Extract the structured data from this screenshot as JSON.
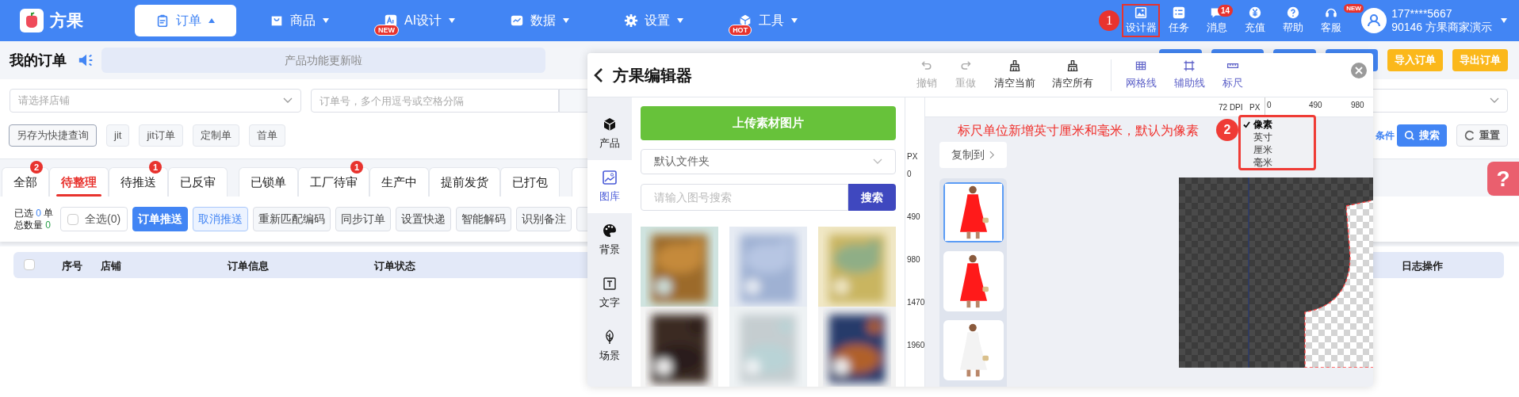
{
  "top_nav": {
    "brand": "方果",
    "items": [
      {
        "label": "订单",
        "selected": true
      },
      {
        "label": "商品",
        "selected": false
      },
      {
        "label": "AI设计",
        "selected": false,
        "tag": "NEW"
      },
      {
        "label": "数据",
        "selected": false
      },
      {
        "label": "设置",
        "selected": false
      },
      {
        "label": "工具",
        "selected": false,
        "tag": "HOT"
      }
    ],
    "tools": [
      {
        "label": "设计器",
        "highlighted": true,
        "callout": "1"
      },
      {
        "label": "任务",
        "highlighted": false
      },
      {
        "label": "消息",
        "highlighted": false,
        "badge": "14"
      },
      {
        "label": "充值",
        "highlighted": false
      },
      {
        "label": "帮助",
        "highlighted": false
      },
      {
        "label": "客服",
        "highlighted": false,
        "tag": "NEW"
      }
    ],
    "user": {
      "phone": "177****5667",
      "account": "90146 方果商家演示"
    }
  },
  "page": {
    "title": "我的订单",
    "notice": "产品功能更新啦",
    "header_buttons": [
      "导入订单",
      "导出订单"
    ]
  },
  "filters": {
    "shop_select": {
      "placeholder": "请选择店铺"
    },
    "order_input": {
      "placeholder": "订单号，多个用逗号或空格分隔"
    },
    "quick_queries": [
      {
        "label": "另存为快捷查询",
        "kind": "save"
      },
      {
        "label": "jit",
        "kind": "query"
      },
      {
        "label": "jit订单",
        "kind": "query"
      },
      {
        "label": "定制单",
        "kind": "query"
      },
      {
        "label": "首单",
        "kind": "query"
      }
    ],
    "more_link": "条件",
    "search_button": "搜索",
    "reset_button": "重置"
  },
  "status_tab_groups": [
    {
      "tabs": [
        {
          "label": "全部",
          "selected": false,
          "badge": "2"
        },
        {
          "label": "待整理",
          "selected": true
        },
        {
          "label": "待推送",
          "selected": false,
          "badge": "1"
        },
        {
          "label": "已反审",
          "selected": false
        }
      ]
    },
    {
      "tabs": [
        {
          "label": "已锁单",
          "selected": false
        },
        {
          "label": "工厂待审",
          "selected": false,
          "badge": "1"
        },
        {
          "label": "生产中",
          "selected": false
        },
        {
          "label": "提前发货",
          "selected": false
        },
        {
          "label": "已打包",
          "selected": false
        }
      ]
    }
  ],
  "summary": {
    "selected_label": "已选",
    "selected_count": "0",
    "selected_unit": "单",
    "total_label": "总数量",
    "total_count": "0"
  },
  "select_all": {
    "label": "全选(0)",
    "checked": false
  },
  "actions": [
    {
      "label": "订单推送",
      "kind": "primary"
    },
    {
      "label": "取消推送",
      "kind": "outline"
    },
    {
      "label": "重新匹配编码",
      "kind": "default"
    },
    {
      "label": "同步订单",
      "kind": "default"
    },
    {
      "label": "设置快递",
      "kind": "default"
    },
    {
      "label": "智能解码",
      "kind": "default"
    },
    {
      "label": "识别备注",
      "kind": "default"
    }
  ],
  "table": {
    "header_checked": false,
    "columns": [
      "序号",
      "店铺",
      "订单信息",
      "订单状态",
      "日志操作"
    ]
  },
  "help_tab": {
    "symbol": "?"
  },
  "editor": {
    "title": "方果编辑器",
    "toolbar": [
      {
        "label": "撤销",
        "kind": "disabled"
      },
      {
        "label": "重做",
        "kind": "disabled"
      },
      {
        "label": "清空当前",
        "kind": "normal"
      },
      {
        "label": "清空所有",
        "kind": "normal"
      },
      {
        "label": "网格线",
        "kind": "view"
      },
      {
        "label": "辅助线",
        "kind": "view"
      },
      {
        "label": "标尺",
        "kind": "view"
      }
    ],
    "sidebar": [
      {
        "label": "产品",
        "selected": false
      },
      {
        "label": "图库",
        "selected": true
      },
      {
        "label": "背景",
        "selected": false
      },
      {
        "label": "文字",
        "selected": false
      },
      {
        "label": "场景",
        "selected": false
      }
    ],
    "upload_button": "上传素材图片",
    "folder_select": "默认文件夹",
    "search": {
      "placeholder": "请输入图号搜索"
    },
    "search_button": "搜索",
    "ruler": {
      "dpi": "72 DPI",
      "unit": "PX",
      "top_ticks": [
        "0",
        "490",
        "980"
      ],
      "side_unit": "PX",
      "side_ticks": [
        "0",
        "490",
        "980",
        "1470",
        "1960"
      ]
    },
    "annotation": "标尺单位新增英寸厘米和毫米，默认为像素",
    "annotation_callout": "2",
    "unit_menu": [
      {
        "label": "像素",
        "selected": true
      },
      {
        "label": "英寸",
        "selected": false
      },
      {
        "label": "厘米",
        "selected": false
      },
      {
        "label": "毫米",
        "selected": false
      }
    ],
    "copy_button": "复制到",
    "thumbnails": [
      {
        "selected": true
      },
      {
        "selected": false
      },
      {
        "selected": false
      }
    ]
  }
}
